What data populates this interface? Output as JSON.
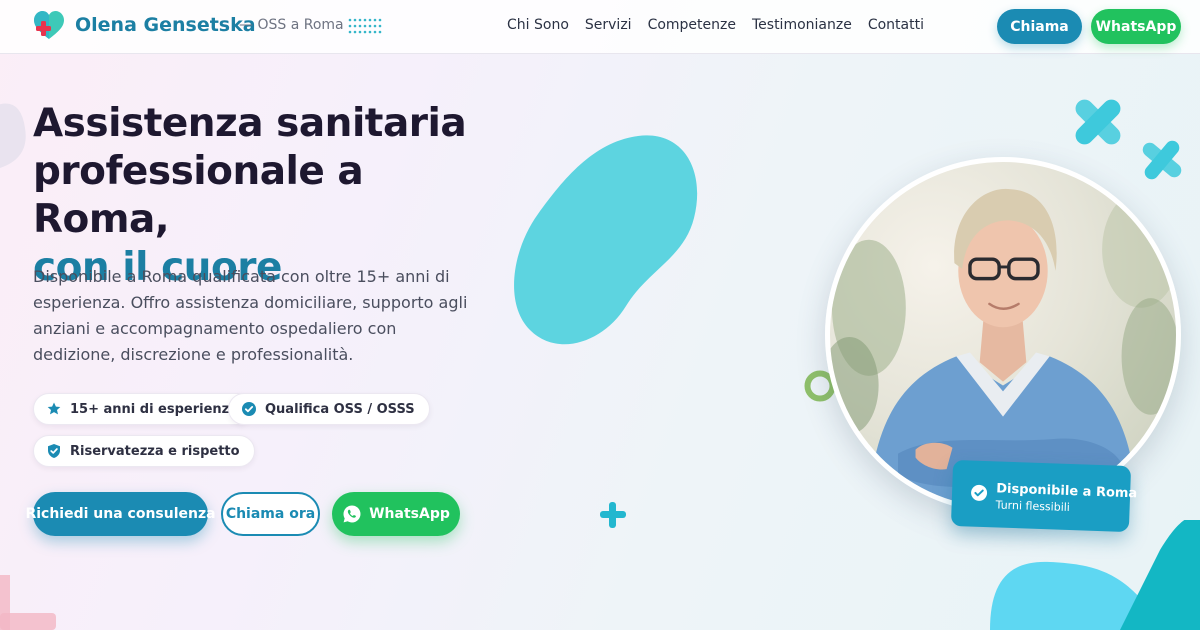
{
  "header": {
    "brand_name": "Olena Gensetska",
    "brand_sub": "— OSS a Roma",
    "nav": [
      "Chi Sono",
      "Servizi",
      "Competenze",
      "Testimonianze",
      "Contatti"
    ],
    "call_label": "Chiama",
    "whatsapp_label": "WhatsApp"
  },
  "hero": {
    "headline_line1": "Assistenza sanitaria",
    "headline_line2": "professionale a Roma,",
    "headline_accent": "con il cuore",
    "lead": "Disponibile a Roma qualificata con oltre 15+ anni di esperienza. Offro assistenza domiciliare, supporto agli anziani e accompagnamento ospedaliero con dedizione, discrezione e professionalità.",
    "badges": [
      "15+ anni di esperienza",
      "Qualifica OSS / OSSS",
      "Riservatezza e rispetto"
    ],
    "cta_primary": "Richiedi una consulenza",
    "cta_call": "Chiama ora",
    "cta_whatsapp": "WhatsApp"
  },
  "status_card": {
    "title": "Disponibile a Roma",
    "subtitle": "Turni flessibili"
  },
  "colors": {
    "primary": "#1b8bb3",
    "whatsapp": "#21c25e",
    "accent_blob": "#5dd4e0",
    "heading": "#1e1830"
  },
  "icons": [
    "heart-cross-logo-icon",
    "dots-grid-icon",
    "star-icon",
    "shield-check-icon",
    "whatsapp-icon",
    "check-circle-icon"
  ]
}
